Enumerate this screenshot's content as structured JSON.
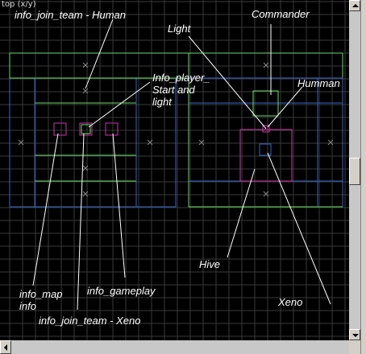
{
  "viewport": {
    "title": "top (x/y)"
  },
  "annotations": {
    "join_human": "info_join_team - Human",
    "commander": "Commander",
    "light": "Light",
    "player_start_1": "Info_player_",
    "player_start_2": "Start and",
    "player_start_3": "light",
    "humman": "Humman",
    "hive": "Hive",
    "info_map_1": "info_map",
    "info_map_2": "info",
    "info_gameplay": "info_gameplay",
    "join_xeno": "info_join_team - Xeno",
    "xeno": "Xeno"
  },
  "colors": {
    "grid": "#3a3a3a",
    "brush_green": "#66dd66",
    "brush_blue": "#3366cc",
    "entity_magenta": "#cc33aa",
    "pointer_white": "#ffffff"
  }
}
